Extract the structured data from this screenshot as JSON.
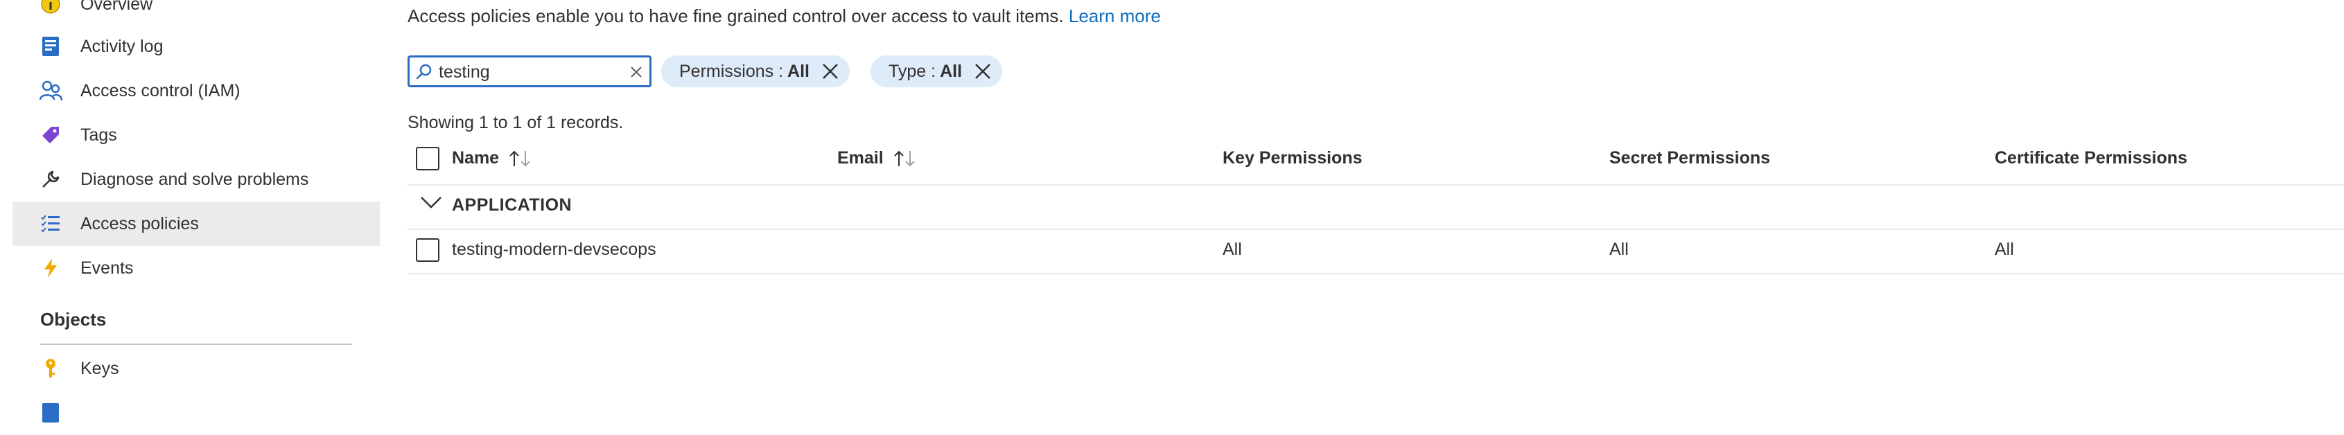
{
  "sidebar": {
    "items": [
      {
        "label": "Overview",
        "icon": "overview-icon"
      },
      {
        "label": "Activity log",
        "icon": "activity-log-icon"
      },
      {
        "label": "Access control (IAM)",
        "icon": "people-icon"
      },
      {
        "label": "Tags",
        "icon": "tag-icon"
      },
      {
        "label": "Diagnose and solve problems",
        "icon": "wrench-icon"
      },
      {
        "label": "Access policies",
        "icon": "list-icon",
        "selected": true
      },
      {
        "label": "Events",
        "icon": "lightning-icon"
      }
    ],
    "objects_section": {
      "title": "Objects",
      "items": [
        {
          "label": "Keys",
          "icon": "key-icon"
        }
      ]
    }
  },
  "main": {
    "intro_text": "Access policies enable you to have fine grained control over access to vault items.",
    "learn_more_label": "Learn more",
    "search": {
      "value": "testing",
      "placeholder": ""
    },
    "filters": [
      {
        "key": "Permissions :",
        "value": "All"
      },
      {
        "key": "Type :",
        "value": "All"
      }
    ],
    "records_text": "Showing 1 to 1 of 1 records.",
    "table": {
      "columns": [
        "Name",
        "Email",
        "Key Permissions",
        "Secret Permissions",
        "Certificate Permissions"
      ],
      "group_label": "APPLICATION",
      "rows": [
        {
          "name": "testing-modern-devsecops",
          "email": "",
          "key_permissions": "All",
          "secret_permissions": "All",
          "certificate_permissions": "All"
        }
      ]
    }
  },
  "colors": {
    "accent": "#0f6cbd",
    "selected_bg": "#edebe9",
    "pill_bg": "#deecf9",
    "search_border": "#2b6cc4"
  }
}
